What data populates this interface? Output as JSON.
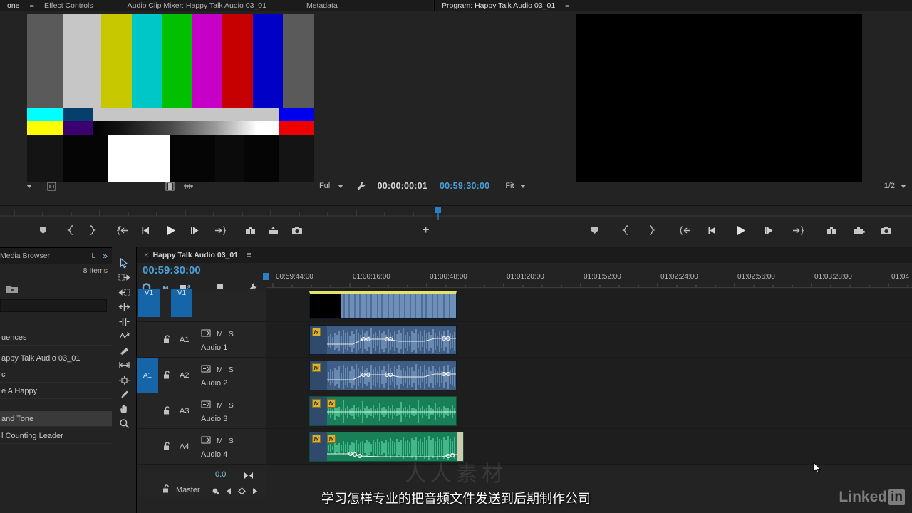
{
  "source_panel": {
    "tabs": [
      {
        "label": "one",
        "active": true
      },
      {
        "label": "Effect Controls",
        "active": false
      },
      {
        "label": "Audio Clip Mixer: Happy Talk Audio 03_01",
        "active": false
      },
      {
        "label": "Metadata",
        "active": false
      }
    ],
    "menu_icon": "panel-menu-icon",
    "fit_label": "Full",
    "timecode": "00:00:00:01",
    "settings_icon": "wrench-icon",
    "transport": [
      {
        "name": "add-marker-button",
        "icon": "marker-icon"
      },
      {
        "name": "mark-in-button",
        "icon": "mark-in-icon"
      },
      {
        "name": "mark-out-button",
        "icon": "mark-out-icon"
      },
      {
        "name": "go-to-in-button",
        "icon": "go-to-in-icon"
      },
      {
        "name": "step-back-button",
        "icon": "step-back-icon"
      },
      {
        "name": "play-stop-button",
        "icon": "play-icon"
      },
      {
        "name": "step-forward-button",
        "icon": "step-forward-icon"
      },
      {
        "name": "go-to-out-button",
        "icon": "go-to-out-icon"
      },
      {
        "name": "insert-button",
        "icon": "insert-icon"
      },
      {
        "name": "overwrite-button",
        "icon": "overwrite-icon"
      },
      {
        "name": "export-frame-button",
        "icon": "camera-icon"
      }
    ],
    "button_editor_label": "+"
  },
  "program_panel": {
    "title": "Program: Happy Talk Audio 03_01",
    "menu_icon": "panel-menu-icon",
    "timecode": "00:59:30:00",
    "fit_label": "Fit",
    "resolution_label": "1/2",
    "transport": [
      {
        "name": "add-marker-button",
        "icon": "marker-icon"
      },
      {
        "name": "mark-in-button",
        "icon": "mark-in-icon"
      },
      {
        "name": "mark-out-button",
        "icon": "mark-out-icon"
      },
      {
        "name": "go-to-in-button",
        "icon": "go-to-in-icon"
      },
      {
        "name": "step-back-button",
        "icon": "step-back-icon"
      },
      {
        "name": "play-stop-button",
        "icon": "play-icon"
      },
      {
        "name": "step-forward-button",
        "icon": "step-forward-icon"
      },
      {
        "name": "go-to-out-button",
        "icon": "go-to-out-icon"
      },
      {
        "name": "lift-button",
        "icon": "lift-icon"
      },
      {
        "name": "extract-button",
        "icon": "extract-icon"
      },
      {
        "name": "export-frame-button",
        "icon": "camera-icon"
      }
    ]
  },
  "project_panel": {
    "tab_label": "Media Browser",
    "tab_letter": "L",
    "overflow_icon": "chevron-double-right-icon",
    "item_count": "8 Items",
    "rows": [
      {
        "label": "uences",
        "selected": false
      },
      {
        "label": "appy Talk Audio 03_01",
        "selected": false
      },
      {
        "label": "c",
        "selected": false
      },
      {
        "label": "e A Happy",
        "selected": false
      },
      {
        "label": "and Tone",
        "selected": true
      },
      {
        "label": "l Counting Leader",
        "selected": false
      }
    ]
  },
  "tools": [
    {
      "name": "selection-tool",
      "icon": "arrow-cursor-icon",
      "active": true
    },
    {
      "name": "track-select-forward-tool",
      "icon": "track-select-forward-icon",
      "active": false
    },
    {
      "name": "track-select-backward-tool",
      "icon": "track-select-backward-icon",
      "active": false
    },
    {
      "name": "ripple-edit-tool",
      "icon": "ripple-edit-icon",
      "active": false
    },
    {
      "name": "rolling-edit-tool",
      "icon": "rolling-edit-icon",
      "active": false
    },
    {
      "name": "rate-stretch-tool",
      "icon": "rate-stretch-icon",
      "active": false
    },
    {
      "name": "razor-tool",
      "icon": "razor-icon",
      "active": false
    },
    {
      "name": "slip-tool",
      "icon": "slip-icon",
      "active": false
    },
    {
      "name": "slide-tool",
      "icon": "slide-icon",
      "active": false
    },
    {
      "name": "pen-tool",
      "icon": "pen-icon",
      "active": false
    },
    {
      "name": "hand-tool",
      "icon": "hand-icon",
      "active": false
    },
    {
      "name": "zoom-tool",
      "icon": "magnifier-icon",
      "active": false
    }
  ],
  "timeline": {
    "close_icon": "close-x-icon",
    "sequence_name": "Happy Talk Audio 03_01",
    "menu_icon": "panel-menu-icon",
    "playhead_timecode": "00:59:30:00",
    "toolbar": [
      {
        "name": "snap-toggle",
        "icon": "snap-magnet-icon"
      },
      {
        "name": "linked-selection-toggle",
        "icon": "link-icon"
      },
      {
        "name": "sync-lock-toggle",
        "icon": "sync-lock-icon"
      },
      {
        "name": "add-marker-button",
        "icon": "marker-icon"
      },
      {
        "name": "timeline-settings-button",
        "icon": "wrench-icon"
      }
    ],
    "ruler_labels": [
      "00:59:44:00",
      "01:00:16:00",
      "01:00:48:00",
      "01:01:20:00",
      "01:01:52:00",
      "01:02:24:00",
      "01:02:56:00",
      "01:03:28:00",
      "01:04"
    ],
    "video_tracks": [
      {
        "sync_label": "V1",
        "name": "V1",
        "toggle_output_icon": "eye-icon",
        "lock_icon": "lock-open-icon"
      }
    ],
    "audio_tracks": [
      {
        "sync_label": "",
        "name": "A1",
        "label2": "Audio 1",
        "lock_icon": "lock-open-icon",
        "speaker_icon": "speaker-icon",
        "mute": "M",
        "solo": "S",
        "waveform_color": "#8fb4d9",
        "clip_color": "#3d5a80"
      },
      {
        "sync_label": "A1",
        "name": "A2",
        "label2": "Audio 2",
        "lock_icon": "lock-open-icon",
        "speaker_icon": "speaker-icon",
        "mute": "M",
        "solo": "S",
        "waveform_color": "#8fb4d9",
        "clip_color": "#3d5a80"
      },
      {
        "sync_label": "",
        "name": "A3",
        "label2": "Audio 3",
        "lock_icon": "lock-open-icon",
        "speaker_icon": "speaker-icon",
        "mute": "M",
        "solo": "S",
        "waveform_color": "#5ddfa8",
        "clip_color": "#1f8a63"
      },
      {
        "sync_label": "",
        "name": "A4",
        "label2": "Audio 4",
        "lock_icon": "lock-open-icon",
        "speaker_icon": "speaker-icon",
        "mute": "M",
        "solo": "S",
        "waveform_color": "#5ddfa8",
        "clip_color": "#1f8a63"
      }
    ],
    "master": {
      "value": "0.0",
      "name": "Master",
      "lock_icon": "lock-open-icon",
      "meter_icon": "meter-icon",
      "keyframe_prev_icon": "prev-keyframe-icon",
      "keyframe_add_icon": "add-keyframe-icon",
      "keyframe_next_icon": "next-keyframe-icon"
    }
  },
  "overlay": {
    "subtitle": "学习怎样专业的把音频文件发送到后期制作公司",
    "watermark": "人人素材",
    "brand_name": "Linked",
    "brand_badge": "in"
  },
  "colors": {
    "accent_blue": "#4a9fd8",
    "track_select_blue": "#1565a8",
    "panel_bg": "#232323",
    "tabbar_bg": "#1b1b1b",
    "audio_blue": "#8fb4d9",
    "audio_green": "#5ddfa8"
  }
}
